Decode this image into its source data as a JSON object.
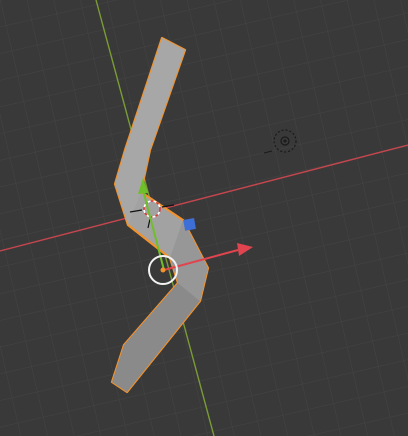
{
  "viewport": {
    "background": "#393939",
    "grid_color": "#444444",
    "x_axis_color": "#c4464e",
    "y_axis_color": "#7a9c35",
    "mesh_fill": "#a2a2a2",
    "mesh_shadow": "#8a8a8a",
    "selection_outline": "#f0922d",
    "gizmo_x_color": "#e0444f",
    "gizmo_y_color": "#6fbf2a",
    "gizmo_z_color": "#3d6fd6"
  }
}
